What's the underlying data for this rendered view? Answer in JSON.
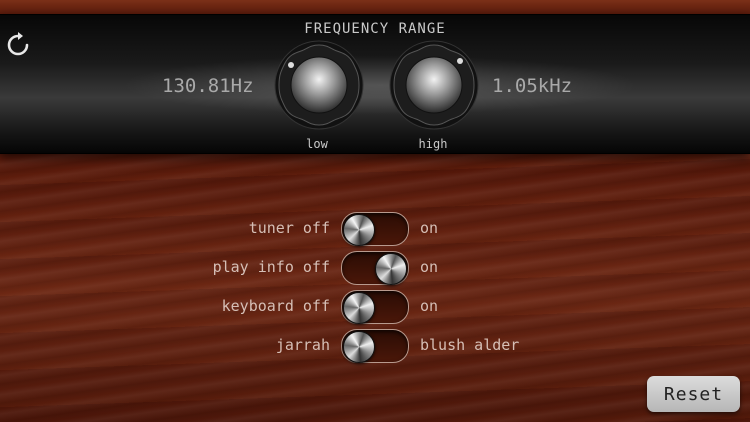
{
  "header": {
    "title": "FREQUENCY RANGE",
    "low_value": "130.81Hz",
    "high_value": "1.05kHz",
    "low_label": "low",
    "high_label": "high"
  },
  "toggles": [
    {
      "off_label": "tuner off",
      "on_label": "on",
      "state": "off"
    },
    {
      "off_label": "play info off",
      "on_label": "on",
      "state": "on"
    },
    {
      "off_label": "keyboard off",
      "on_label": "on",
      "state": "off"
    },
    {
      "off_label": "jarrah",
      "on_label": "blush alder",
      "state": "off"
    }
  ],
  "reset_label": "Reset",
  "icons": {
    "top_left": "reset-circular-icon"
  },
  "colors": {
    "wood": "#5a1b0c",
    "panel": "#1a1a1a",
    "label_text": "#d6bfb6"
  }
}
